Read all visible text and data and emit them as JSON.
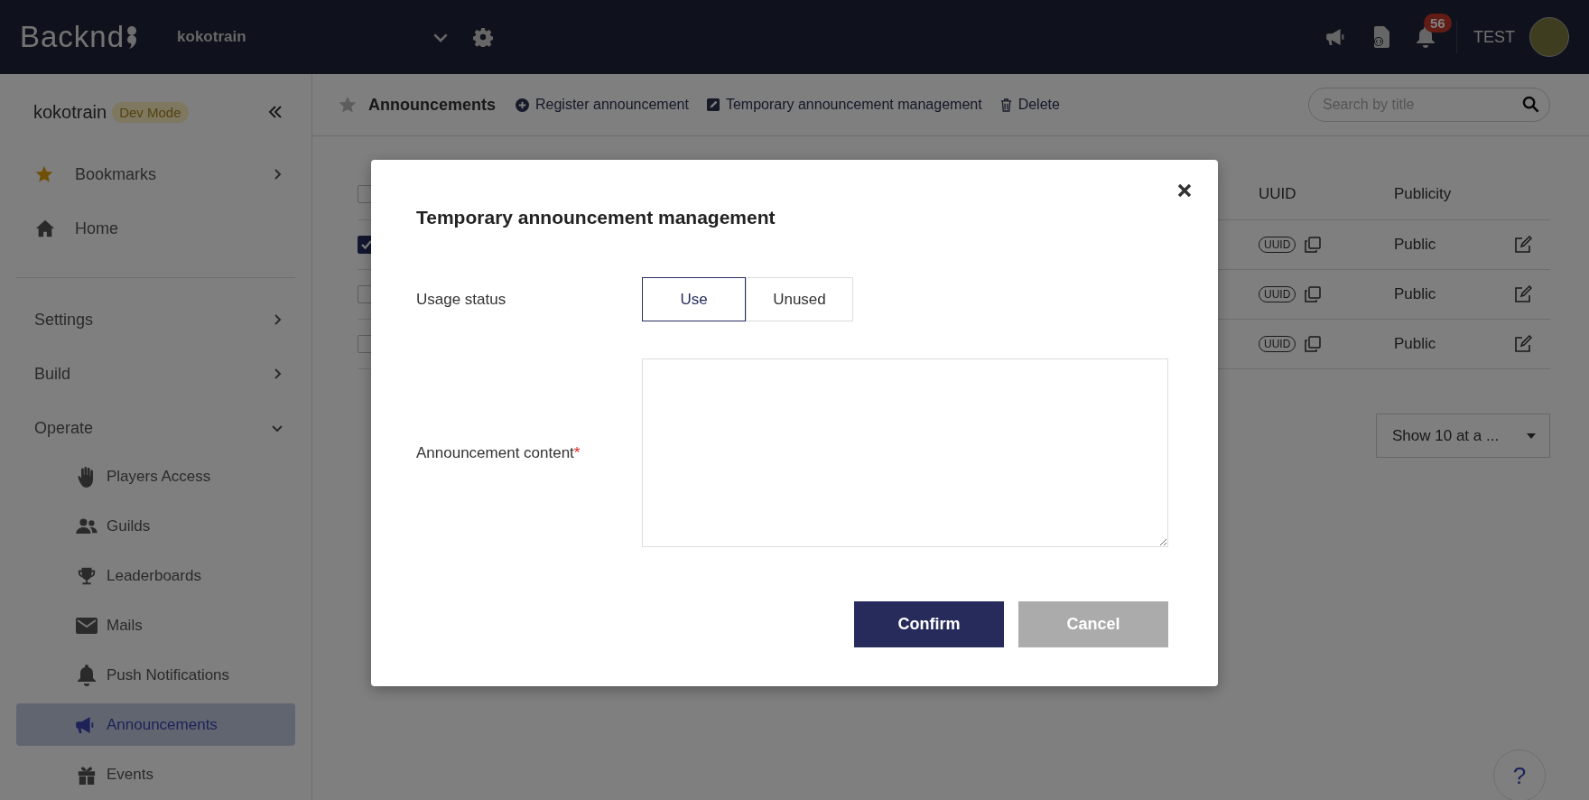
{
  "top_bar": {
    "logo": "Backnd",
    "project": "kokotrain",
    "notification_count": "56",
    "user": "TEST"
  },
  "sidebar": {
    "project": "kokotrain",
    "badge": "Dev Mode",
    "items": [
      {
        "label": "Bookmarks",
        "kind": "group",
        "expanded": false
      },
      {
        "label": "Home",
        "kind": "link"
      }
    ],
    "sections": [
      {
        "label": "Settings",
        "expanded": false
      },
      {
        "label": "Build",
        "expanded": false
      },
      {
        "label": "Operate",
        "expanded": true,
        "children": [
          {
            "label": "Players Access",
            "selected": false
          },
          {
            "label": "Guilds",
            "selected": false
          },
          {
            "label": "Leaderboards",
            "selected": false
          },
          {
            "label": "Mails",
            "selected": false
          },
          {
            "label": "Push Notifications",
            "selected": false
          },
          {
            "label": "Announcements",
            "selected": true
          },
          {
            "label": "Events",
            "selected": false
          }
        ]
      }
    ]
  },
  "toolbar": {
    "title": "Announcements",
    "actions": [
      "Register announcement",
      "Temporary announcement management",
      "Delete"
    ],
    "search": {
      "placeholder": "Search by title"
    }
  },
  "table": {
    "header_checked": false,
    "columns": [
      {
        "label": "UUID"
      },
      {
        "label": "Publicity"
      }
    ],
    "rows": [
      {
        "checked": true,
        "uuid": "UUID",
        "publicity": "Public"
      },
      {
        "checked": false,
        "uuid": "UUID",
        "publicity": "Public"
      },
      {
        "checked": false,
        "uuid": "UUID",
        "publicity": "Public"
      }
    ]
  },
  "pagination": {
    "page_size": "Show 10 at a ..."
  },
  "help": "?",
  "modal": {
    "title": "Temporary announcement management",
    "usage_label": "Usage status",
    "usage_options": [
      {
        "label": "Use",
        "selected": true
      },
      {
        "label": "Unused",
        "selected": false
      }
    ],
    "content_label": "Announcement content",
    "required_mark": "*",
    "buttons": [
      {
        "label": "Confirm",
        "kind": "primary"
      },
      {
        "label": "Cancel",
        "kind": "secondary"
      }
    ]
  }
}
